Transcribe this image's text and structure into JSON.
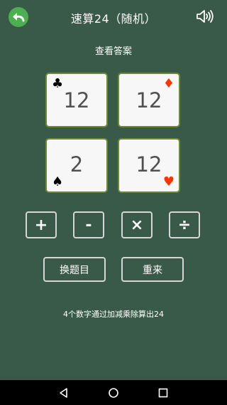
{
  "header": {
    "title": "速算24（随机）",
    "back_icon": "back-arrow-icon",
    "sound_icon": "speaker-icon"
  },
  "show_answer_label": "查看答案",
  "cards": [
    {
      "value": "12",
      "suit": "clubs",
      "suit_symbol": "♣",
      "suit_color": "#000000"
    },
    {
      "value": "12",
      "suit": "diamonds",
      "suit_symbol": "♦",
      "suit_color": "#ff3300"
    },
    {
      "value": "2",
      "suit": "spades",
      "suit_symbol": "♠",
      "suit_color": "#000000"
    },
    {
      "value": "12",
      "suit": "hearts",
      "suit_symbol": "♥",
      "suit_color": "#ff3300"
    }
  ],
  "operators": [
    "+",
    "-",
    "×",
    "÷"
  ],
  "actions": {
    "change_label": "换题目",
    "reset_label": "重来"
  },
  "hint": "4个数字通过加减乘除算出24",
  "colors": {
    "background": "#3a5a49",
    "accent": "#4caf50",
    "card_border": "#6b8b2f"
  }
}
